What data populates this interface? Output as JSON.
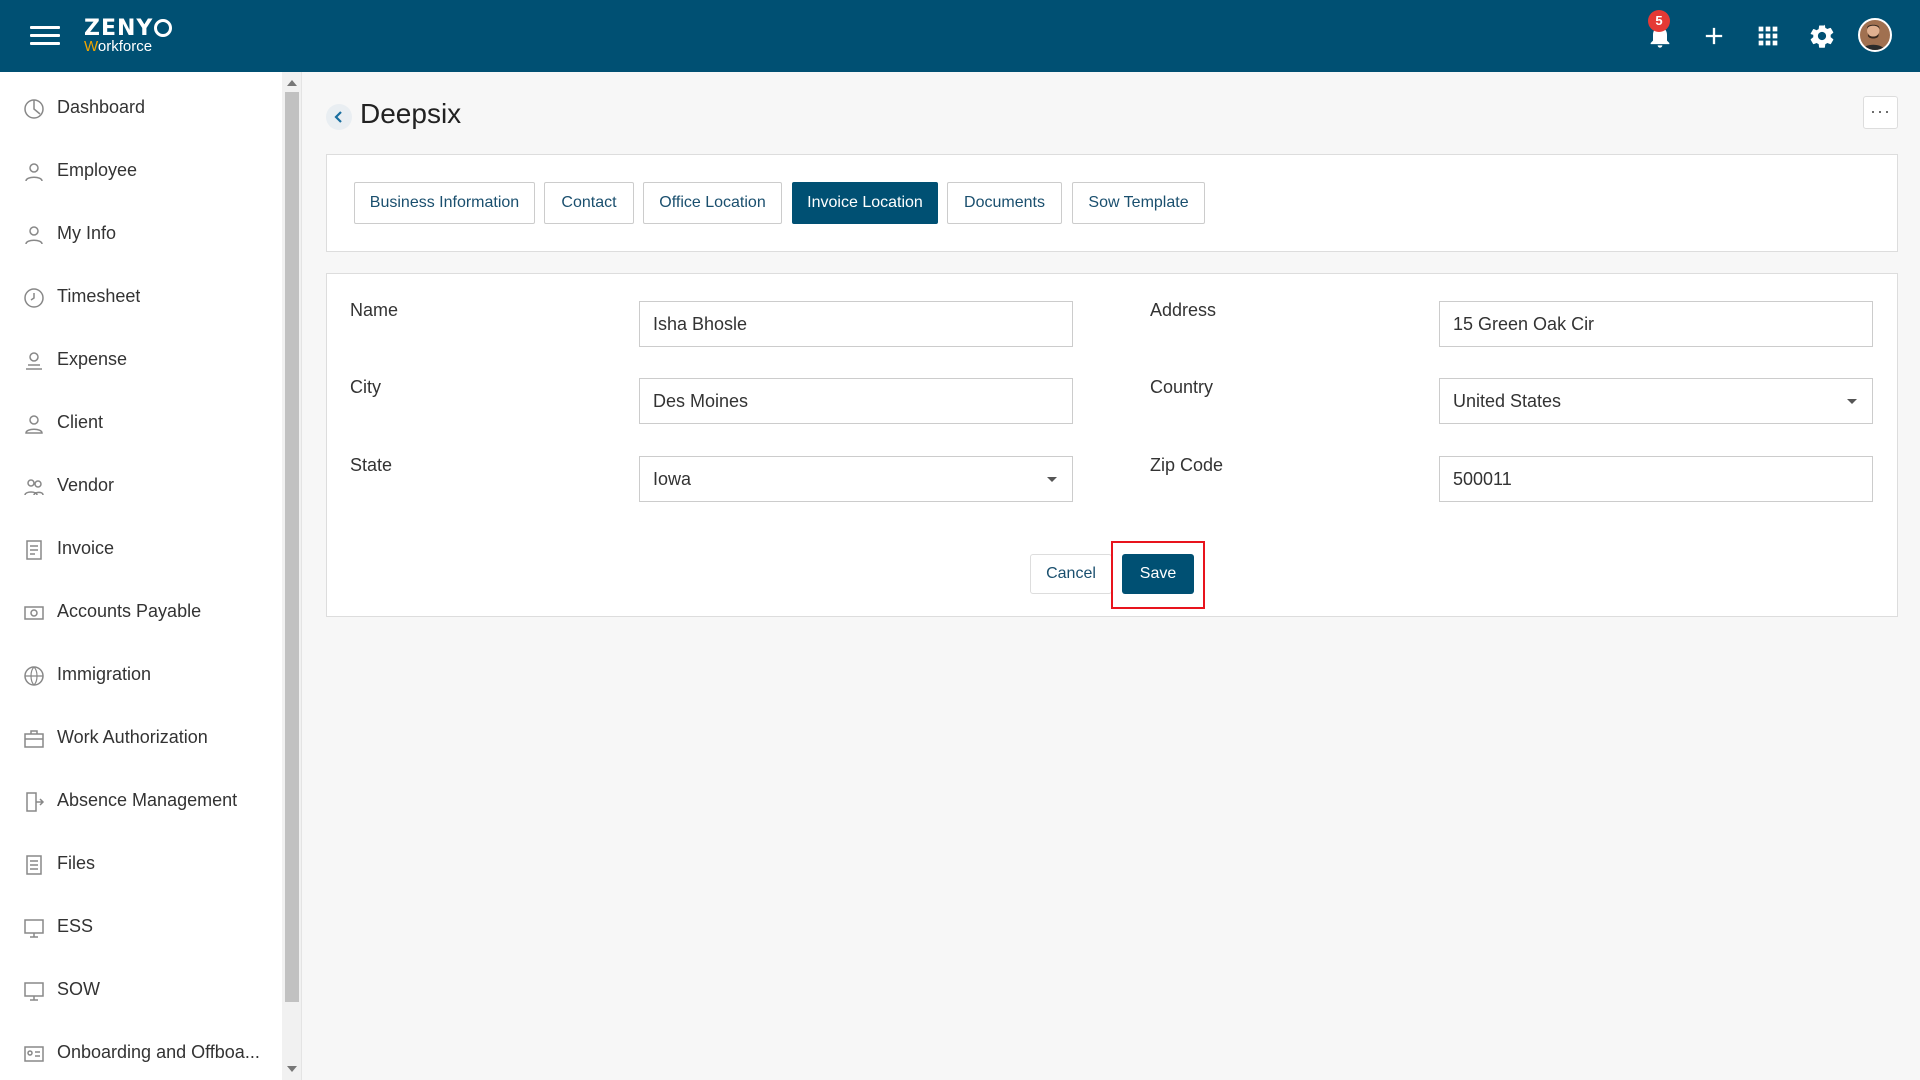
{
  "app": {
    "logo_top": "ZENY",
    "logo_bottom_first": "W",
    "logo_bottom_rest": "orkforce",
    "notification_count": "5"
  },
  "header_icons": [
    "bell-icon",
    "plus-icon",
    "apps-grid-icon",
    "gear-icon",
    "user-avatar"
  ],
  "sidebar": {
    "items": [
      {
        "label": "Dashboard",
        "icon": "dashboard-icon"
      },
      {
        "label": "Employee",
        "icon": "employee-icon"
      },
      {
        "label": "My Info",
        "icon": "my-info-icon"
      },
      {
        "label": "Timesheet",
        "icon": "clock-icon"
      },
      {
        "label": "Expense",
        "icon": "expense-icon"
      },
      {
        "label": "Client",
        "icon": "client-icon"
      },
      {
        "label": "Vendor",
        "icon": "vendor-icon"
      },
      {
        "label": "Invoice",
        "icon": "invoice-icon"
      },
      {
        "label": "Accounts Payable",
        "icon": "accounts-payable-icon"
      },
      {
        "label": "Immigration",
        "icon": "globe-icon"
      },
      {
        "label": "Work Authorization",
        "icon": "briefcase-icon"
      },
      {
        "label": "Absence Management",
        "icon": "door-exit-icon"
      },
      {
        "label": "Files",
        "icon": "files-icon"
      },
      {
        "label": "ESS",
        "icon": "ess-icon"
      },
      {
        "label": "SOW",
        "icon": "sow-icon"
      },
      {
        "label": "Onboarding and Offboa...",
        "icon": "id-card-icon"
      }
    ]
  },
  "page": {
    "title": "Deepsix",
    "more_label": "···"
  },
  "tabs": [
    {
      "label": "Business Information",
      "active": false
    },
    {
      "label": "Contact",
      "active": false
    },
    {
      "label": "Office Location",
      "active": false
    },
    {
      "label": "Invoice Location",
      "active": true
    },
    {
      "label": "Documents",
      "active": false
    },
    {
      "label": "Sow Template",
      "active": false
    }
  ],
  "form": {
    "name_label": "Name",
    "name_value": "Isha Bhosle",
    "address_label": "Address",
    "address_value": "15 Green Oak Cir",
    "city_label": "City",
    "city_value": "Des Moines",
    "country_label": "Country",
    "country_value": "United States",
    "state_label": "State",
    "state_value": "Iowa",
    "zip_label": "Zip Code",
    "zip_value": "500011",
    "cancel_label": "Cancel",
    "save_label": "Save"
  },
  "colors": {
    "primary": "#005073",
    "badge": "#e53935",
    "highlight": "#e8141d",
    "logo_accent": "#f0a500"
  }
}
